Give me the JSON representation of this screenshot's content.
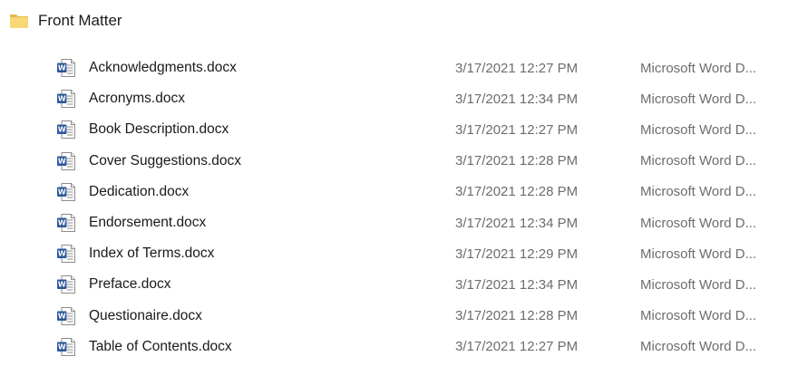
{
  "folder": {
    "title": "Front Matter",
    "icon": "folder-icon",
    "color": "#F8D775"
  },
  "files": [
    {
      "name": "Acknowledgments.docx",
      "date": "3/17/2021 12:27 PM",
      "type": "Microsoft Word D...",
      "icon": "word-document-icon"
    },
    {
      "name": "Acronyms.docx",
      "date": "3/17/2021 12:34 PM",
      "type": "Microsoft Word D...",
      "icon": "word-document-icon"
    },
    {
      "name": "Book Description.docx",
      "date": "3/17/2021 12:27 PM",
      "type": "Microsoft Word D...",
      "icon": "word-document-icon"
    },
    {
      "name": "Cover Suggestions.docx",
      "date": "3/17/2021 12:28 PM",
      "type": "Microsoft Word D...",
      "icon": "word-document-icon"
    },
    {
      "name": "Dedication.docx",
      "date": "3/17/2021 12:28 PM",
      "type": "Microsoft Word D...",
      "icon": "word-document-icon"
    },
    {
      "name": "Endorsement.docx",
      "date": "3/17/2021 12:34 PM",
      "type": "Microsoft Word D...",
      "icon": "word-document-icon"
    },
    {
      "name": "Index of Terms.docx",
      "date": "3/17/2021 12:29 PM",
      "type": "Microsoft Word D...",
      "icon": "word-document-icon"
    },
    {
      "name": "Preface.docx",
      "date": "3/17/2021 12:34 PM",
      "type": "Microsoft Word D...",
      "icon": "word-document-icon"
    },
    {
      "name": "Questionaire.docx",
      "date": "3/17/2021 12:28 PM",
      "type": "Microsoft Word D...",
      "icon": "word-document-icon"
    },
    {
      "name": "Table of Contents.docx",
      "date": "3/17/2021 12:27 PM",
      "type": "Microsoft Word D...",
      "icon": "word-document-icon"
    }
  ],
  "colors": {
    "word_blue": "#2B579A",
    "secondary_text": "#6D6D6D"
  }
}
